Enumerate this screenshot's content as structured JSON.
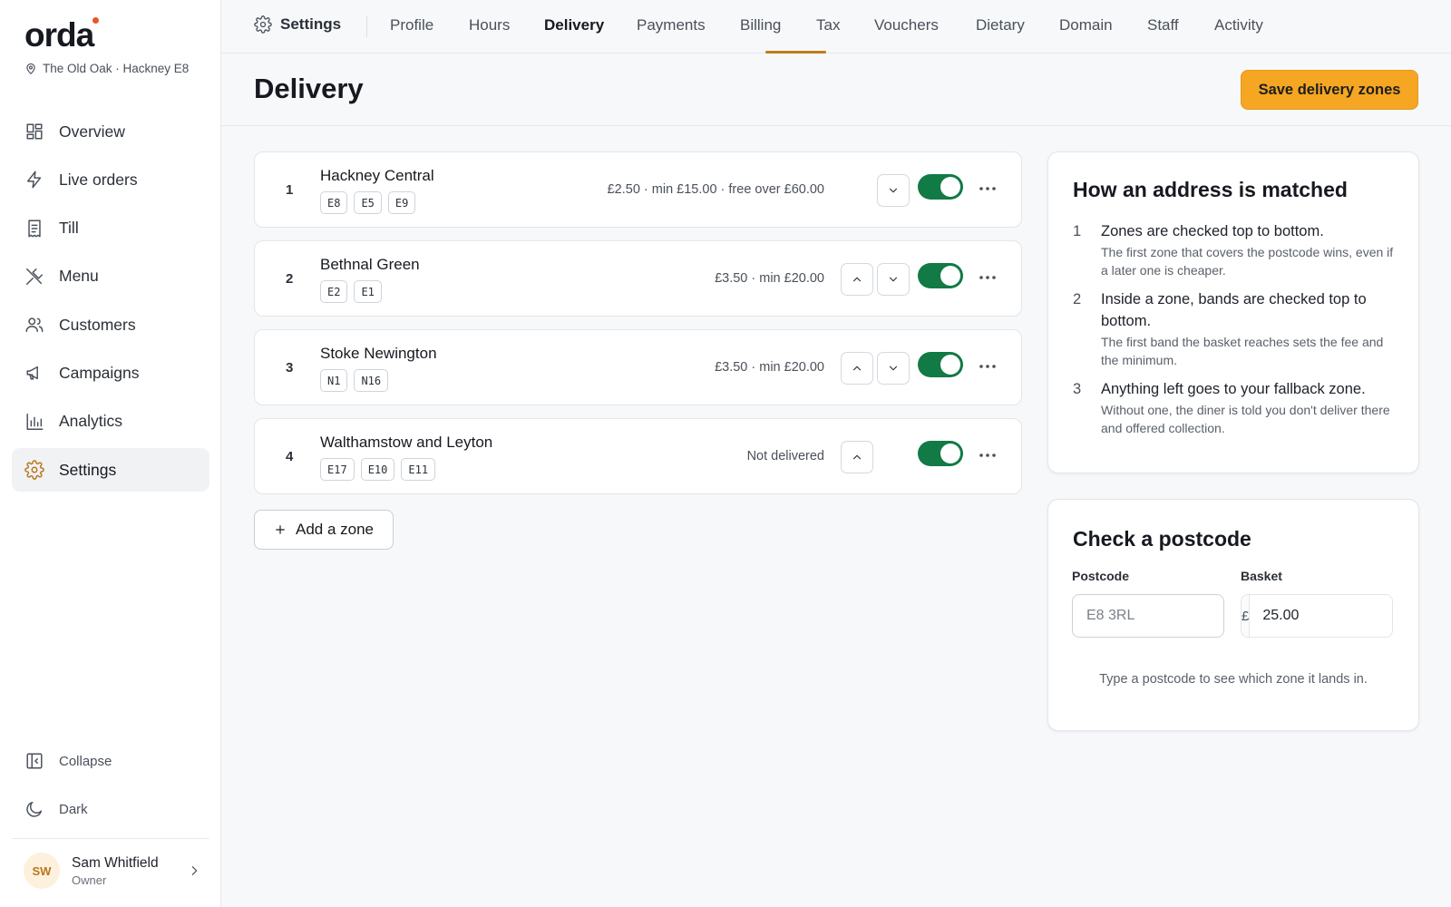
{
  "brand": {
    "logo": "orda",
    "venue": "The Old Oak · Hackney E8"
  },
  "sidebar": {
    "items": [
      {
        "label": "Overview",
        "icon": "grid-icon"
      },
      {
        "label": "Live orders",
        "icon": "bolt-icon"
      },
      {
        "label": "Till",
        "icon": "receipt-icon"
      },
      {
        "label": "Menu",
        "icon": "utensils-icon"
      },
      {
        "label": "Customers",
        "icon": "users-icon"
      },
      {
        "label": "Campaigns",
        "icon": "megaphone-icon"
      },
      {
        "label": "Analytics",
        "icon": "chart-icon"
      },
      {
        "label": "Settings",
        "icon": "gear-icon",
        "active": true
      }
    ],
    "collapse_label": "Collapse",
    "dark_label": "Dark",
    "user": {
      "initials": "SW",
      "name": "Sam Whitfield",
      "role": "Owner"
    }
  },
  "tabs": {
    "section": "Settings",
    "items": [
      "Profile",
      "Hours",
      "Delivery",
      "Payments",
      "Billing",
      "Tax",
      "Vouchers",
      "Dietary",
      "Domain",
      "Staff",
      "Activity"
    ],
    "active": "Delivery"
  },
  "page": {
    "title": "Delivery",
    "save_label": "Save delivery zones"
  },
  "zones": [
    {
      "num": "1",
      "name": "Hackney Central",
      "postcodes": [
        "E8",
        "E5",
        "E9"
      ],
      "price": "£2.50 · min £15.00 · free over £60.00",
      "up": false,
      "down": true,
      "enabled": true
    },
    {
      "num": "2",
      "name": "Bethnal Green",
      "postcodes": [
        "E2",
        "E1"
      ],
      "price": "£3.50 · min £20.00",
      "up": true,
      "down": true,
      "enabled": true
    },
    {
      "num": "3",
      "name": "Stoke Newington",
      "postcodes": [
        "N1",
        "N16"
      ],
      "price": "£3.50 · min £20.00",
      "up": true,
      "down": true,
      "enabled": true
    },
    {
      "num": "4",
      "name": "Walthamstow and Leyton",
      "postcodes": [
        "E17",
        "E10",
        "E11"
      ],
      "price": "Not delivered",
      "up": true,
      "down": false,
      "enabled": true
    }
  ],
  "add_zone_label": "Add a zone",
  "matching": {
    "title": "How an address is matched",
    "steps": [
      {
        "n": "1",
        "title": "Zones are checked top to bottom.",
        "desc": "The first zone that covers the postcode wins, even if a later one is cheaper."
      },
      {
        "n": "2",
        "title": "Inside a zone, bands are checked top to bottom.",
        "desc": "The first band the basket reaches sets the fee and the minimum."
      },
      {
        "n": "3",
        "title": "Anything left goes to your fallback zone.",
        "desc": "Without one, the diner is told you don't deliver there and offered collection."
      }
    ]
  },
  "check": {
    "title": "Check a postcode",
    "postcode_label": "Postcode",
    "postcode_placeholder": "E8 3RL",
    "basket_label": "Basket",
    "currency": "£",
    "basket_value": "25.00",
    "hint": "Type a postcode to see which zone it lands in."
  },
  "colors": {
    "accent": "#f5a623",
    "toggle_on": "#127a45",
    "active_tab_underline": "#c07d1a"
  }
}
